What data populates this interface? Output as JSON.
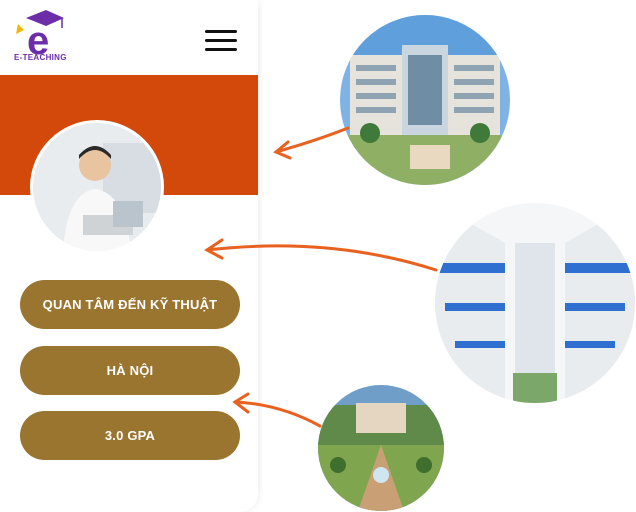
{
  "brand": {
    "name": "E-TEACHING",
    "letter": "e"
  },
  "profile": {
    "tags": [
      "QUAN TÂM ĐẾN KỸ THUẬT",
      "HÀ NỘI",
      "3.0 GPA"
    ]
  },
  "colors": {
    "banner": "#d3490b",
    "pill": "#9a7530",
    "arrow": "#e8611f",
    "logo_purple": "#6b2ea8",
    "logo_gold": "#f2b705"
  }
}
